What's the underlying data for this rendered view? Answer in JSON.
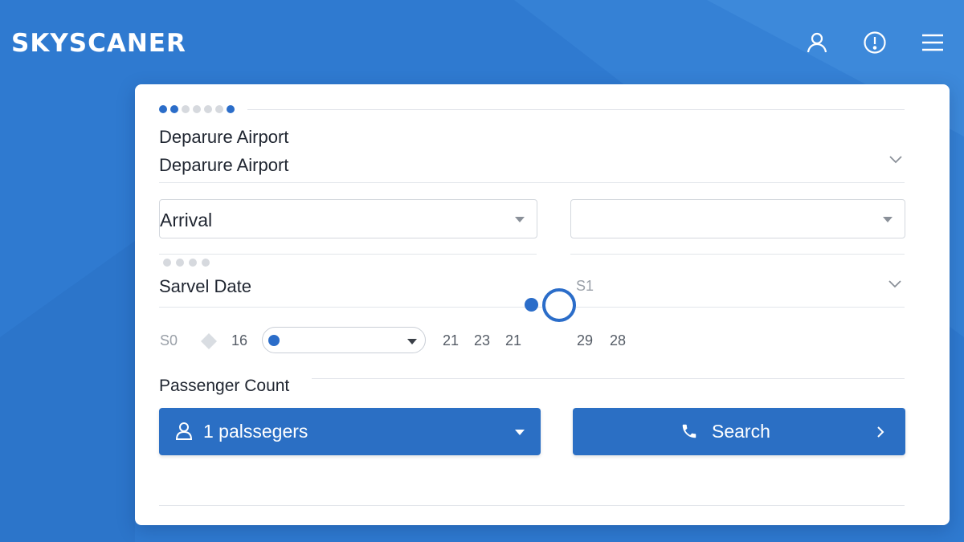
{
  "app": {
    "brand": "SKYSCANER"
  },
  "header": {
    "icons": [
      "user-icon",
      "info-icon",
      "menu-icon"
    ]
  },
  "colors": {
    "background": "#2f7ad0",
    "accent": "#2b6dc9",
    "button": "#2b6fc4",
    "card": "#ffffff"
  },
  "form": {
    "progress": {
      "total": 7,
      "active_positions": [
        1,
        2,
        7
      ]
    },
    "departure": {
      "label": "Deparure Airport",
      "value": "Deparure Airport"
    },
    "arrival": {
      "value": "Arrival",
      "second_value": ""
    },
    "travel_dates": {
      "step_total": 4,
      "label": "Sarvel Date",
      "right_value": "S1",
      "numbers_left": [
        "S0",
        "16"
      ],
      "numbers_mid": [
        "21",
        "23",
        "21"
      ],
      "numbers_right": [
        "29",
        "28"
      ]
    },
    "passengers": {
      "label": "Passenger Count",
      "value": "1 palssegers"
    },
    "search_button": {
      "label": "Search"
    }
  }
}
